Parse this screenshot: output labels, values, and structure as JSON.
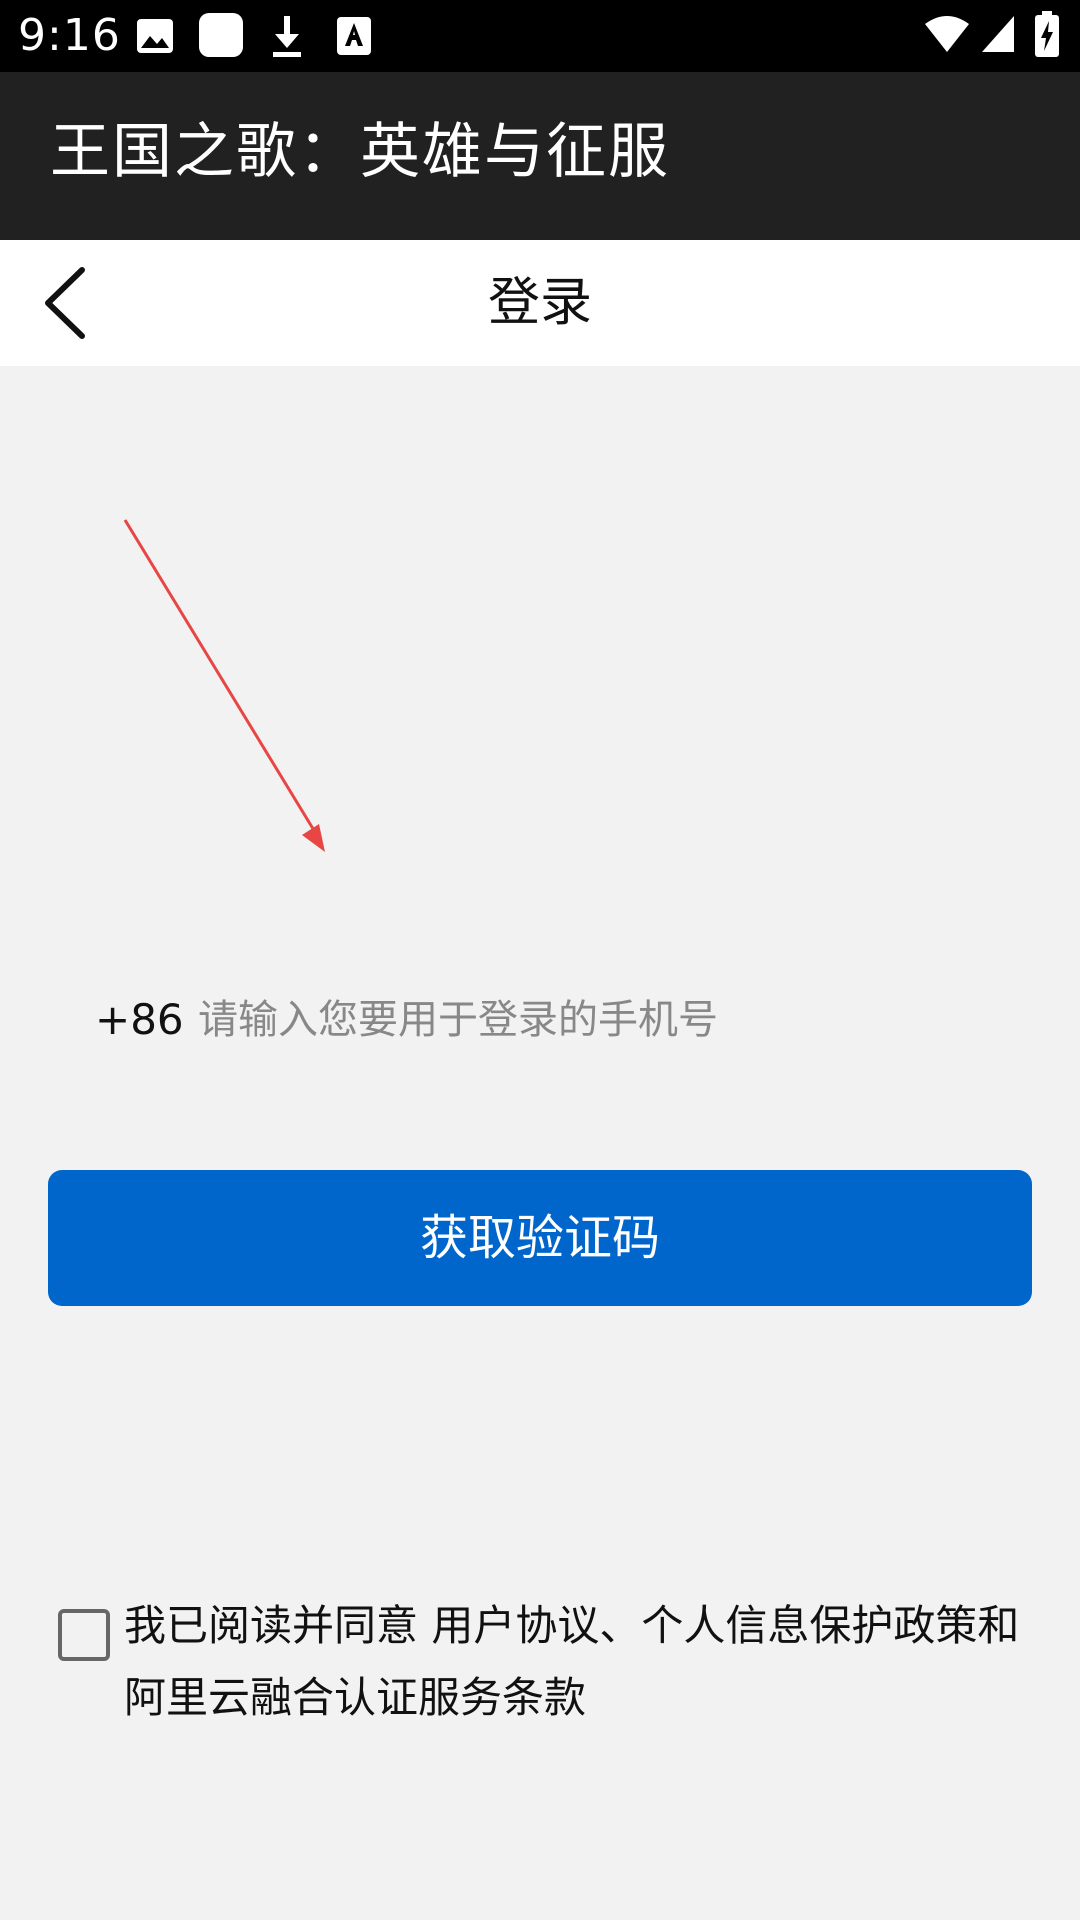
{
  "status_bar": {
    "time": "9:16",
    "left_icons": [
      "image-icon",
      "app-icon",
      "download-icon",
      "font-icon"
    ],
    "right_icons": [
      "wifi-icon",
      "signal-icon",
      "battery-charging-icon"
    ]
  },
  "app_bar": {
    "title": "王国之歌：英雄与征服"
  },
  "nav": {
    "title": "登录",
    "back_icon": "chevron-left-icon"
  },
  "annotation": {
    "color": "#e84545"
  },
  "phone": {
    "country_code": "+86",
    "placeholder": "请输入您要用于登录的手机号",
    "value": ""
  },
  "get_code_button": {
    "label": "获取验证码",
    "color": "#0066cc"
  },
  "agreement": {
    "checked": false,
    "prefix": "我已阅读并同意 ",
    "user_agreement": "用户协议",
    "separator": "、",
    "privacy_policy": "个人信息保护政策",
    "conjunction": "和",
    "auth_terms": "阿里云融合认证服务条款"
  }
}
